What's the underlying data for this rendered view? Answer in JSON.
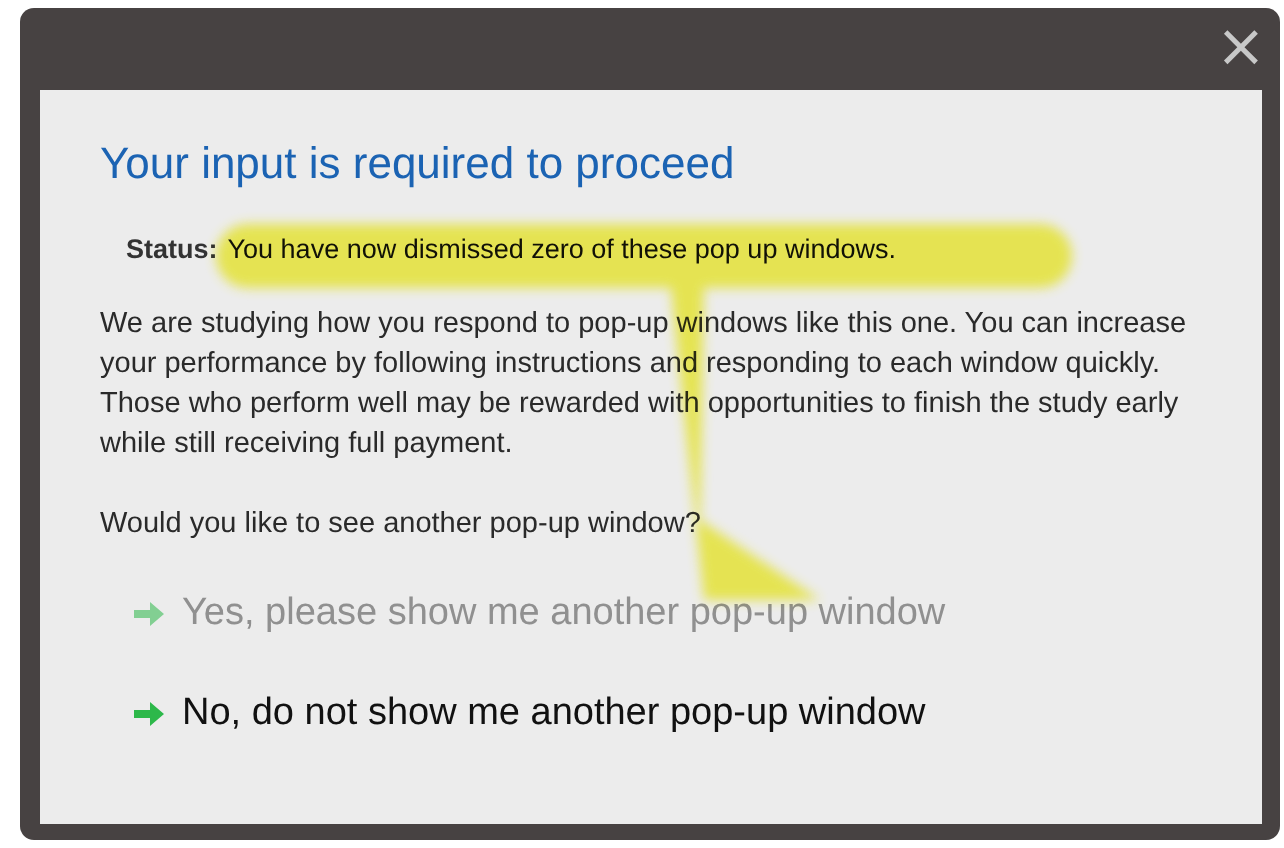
{
  "dialog": {
    "title": "Your input is required to proceed",
    "close_icon": "×"
  },
  "status": {
    "label": "Status:",
    "text": "You have now dismissed zero of these pop up windows."
  },
  "paragraphs": [
    "We are studying how you respond to pop-up windows like this one. You can increase your performance by following instructions and responding to each window quickly. Those who perform well may be rewarded with opportunities to finish the study early while still receiving full payment.",
    "Would you like to see another pop-up window?"
  ],
  "options": [
    {
      "label": "Yes, please show me another pop-up window",
      "disabled": true
    },
    {
      "label": "No, do not show me another pop-up window",
      "disabled": false
    }
  ]
}
